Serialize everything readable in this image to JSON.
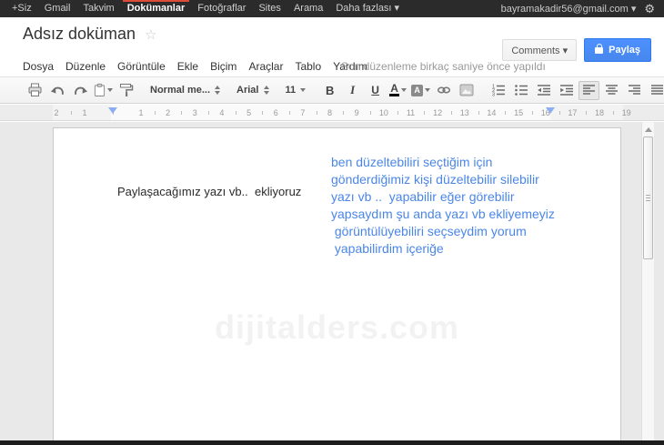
{
  "topbar": {
    "items": [
      "+Siz",
      "Gmail",
      "Takvim",
      "Dokümanlar",
      "Fotoğraflar",
      "Sites",
      "Arama",
      "Daha fazlası ▾"
    ],
    "active_item": "Dokümanlar",
    "account_label": "bayramakadir56@gmail.com ▾",
    "accent_red": "#dd4b39"
  },
  "header": {
    "title": "Adsız doküman",
    "comments_label": "Comments ▾",
    "share_label": "Paylaş",
    "share_color": "#4d90fe"
  },
  "menubar": {
    "items": [
      "Dosya",
      "Düzenle",
      "Görüntüle",
      "Ekle",
      "Biçim",
      "Araçlar",
      "Tablo",
      "Yardım"
    ],
    "status": "Son düzenleme birkaç saniye önce yapıldı"
  },
  "toolbar": {
    "style_value": "Normal me...",
    "font_value": "Arial",
    "size_value": "11",
    "bold_label": "B",
    "italic_label": "I",
    "underline_label": "U",
    "text_color_label": "A",
    "highlight_label": "A"
  },
  "ruler": {
    "margin_numbers": [
      "2",
      "1"
    ],
    "numbers": [
      "1",
      "2",
      "3",
      "4",
      "5",
      "6",
      "7",
      "8",
      "9",
      "10",
      "11",
      "12",
      "13",
      "14",
      "15",
      "16",
      "17",
      "18",
      "19"
    ]
  },
  "document": {
    "left_text": "Paylaşacağımız yazı vb..  ekliyoruz",
    "blue_lines": [
      "ben düzeltebiliri seçtiğim için",
      "gönderdiğimiz kişi düzeltebilir silebilir",
      "yazı vb ..  yapabilir eğer görebilir",
      "yapsaydım şu anda yazı vb ekliyemeyiz",
      " görüntülüyebiliri seçseydim yorum",
      " yapabilirdim içeriğe"
    ],
    "blue_color": "#4a86e8",
    "watermark": "dijitalders.com"
  }
}
